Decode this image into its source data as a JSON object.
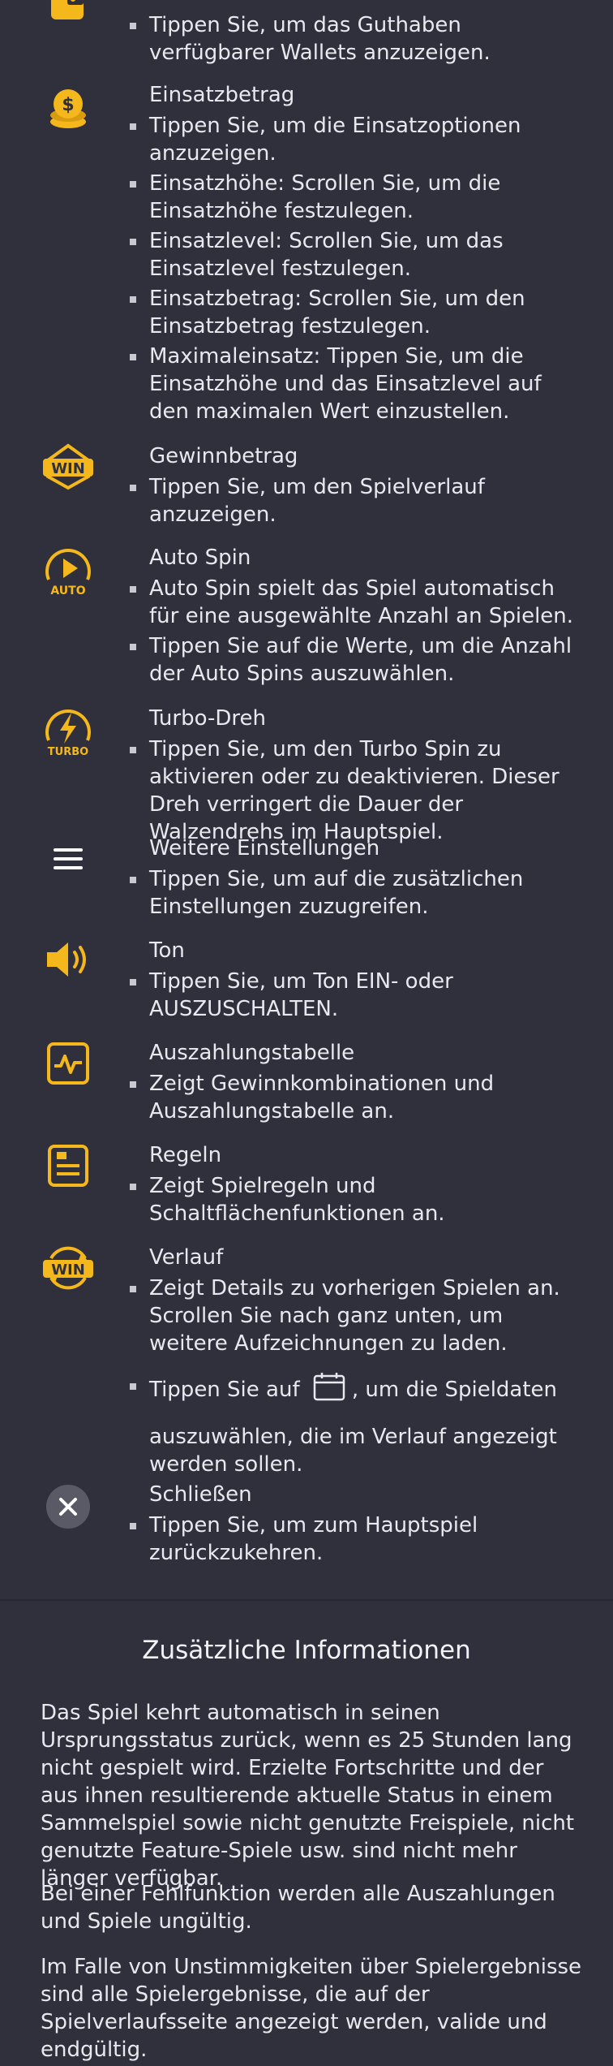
{
  "colors": {
    "background": "#30303c",
    "accent": "#f5b81c",
    "text": "#e8e8ee"
  },
  "items": [
    {
      "id": "wallet",
      "icon": "wallet-icon",
      "title": "",
      "bullets": [
        "Tippen Sie, um das Guthaben verfügbarer Wallets anzuzeigen."
      ]
    },
    {
      "id": "bet",
      "icon": "coin-stack-icon",
      "title": "Einsatzbetrag",
      "bullets": [
        "Tippen Sie, um die Einsatzoptionen anzuzeigen.",
        "Einsatzhöhe: Scrollen Sie, um die Einsatzhöhe festzulegen.",
        "Einsatzlevel: Scrollen Sie, um das Einsatzlevel festzulegen.",
        "Einsatzbetrag: Scrollen Sie, um den Einsatzbetrag festzulegen.",
        "Maximaleinsatz: Tippen Sie, um die Einsatzhöhe und das Einsatzlevel auf den maximalen Wert einzustellen."
      ]
    },
    {
      "id": "win",
      "icon": "win-badge-icon",
      "icon_text": "WIN",
      "title": "Gewinnbetrag",
      "bullets": [
        "Tippen Sie, um den Spielverlauf anzuzeigen."
      ]
    },
    {
      "id": "auto",
      "icon": "auto-spin-icon",
      "icon_text": "AUTO",
      "title": "Auto Spin",
      "bullets": [
        "Auto Spin spielt das Spiel automatisch für eine ausgewählte Anzahl an Spielen.",
        "Tippen Sie auf die Werte, um die Anzahl der Auto Spins auszuwählen."
      ]
    },
    {
      "id": "turbo",
      "icon": "turbo-icon",
      "icon_text": "TURBO",
      "title": "Turbo-Dreh",
      "bullets": [
        "Tippen Sie, um den Turbo Spin zu aktivieren oder zu deaktivieren. Dieser Dreh verringert die Dauer der Walzendrehs im Hauptspiel."
      ]
    },
    {
      "id": "settings",
      "icon": "menu-icon",
      "title": "Weitere Einstellungen",
      "bullets": [
        "Tippen Sie, um auf die zusätzlichen Einstellungen zuzugreifen."
      ]
    },
    {
      "id": "sound",
      "icon": "speaker-icon",
      "title": "Ton",
      "bullets": [
        "Tippen Sie, um Ton EIN- oder AUSZUSCHALTEN."
      ]
    },
    {
      "id": "paytable",
      "icon": "paytable-chart-icon",
      "title": "Auszahlungstabelle",
      "bullets": [
        "Zeigt Gewinnkombinationen und Auszahlungstabelle an."
      ]
    },
    {
      "id": "rules",
      "icon": "rules-document-icon",
      "title": "Regeln",
      "bullets": [
        "Zeigt Spielregeln und Schaltflächenfunktionen an."
      ]
    },
    {
      "id": "history",
      "icon": "history-win-icon",
      "icon_text": "WIN",
      "title": "Verlauf",
      "bullets": [
        "Zeigt Details zu vorherigen Spielen an. Scrollen Sie nach ganz unten, um weitere Aufzeichnungen zu laden."
      ],
      "calendar_bullet": {
        "before": "Tippen Sie auf",
        "after": ", um die Spieldaten",
        "rest": "auszuwählen, die im Verlauf angezeigt werden sollen."
      }
    },
    {
      "id": "close",
      "icon": "close-icon",
      "title": "Schließen",
      "bullets": [
        "Tippen Sie, um zum Hauptspiel zurückzukehren."
      ]
    }
  ],
  "additional": {
    "title": "Zusätzliche Informationen",
    "paragraphs": [
      "Das Spiel kehrt automatisch in seinen Ursprungsstatus zurück, wenn es 25 Stunden lang nicht gespielt wird. Erzielte Fortschritte und der aus ihnen resultierende aktuelle Status in einem Sammelspiel sowie nicht genutzte Freispiele, nicht genutzte Feature-Spiele usw. sind nicht mehr länger verfügbar.",
      "Bei einer Fehlfunktion werden alle Auszahlungen und Spiele ungültig.",
      "Im Falle von Unstimmigkeiten über Spielergebnisse sind alle Spielergebnisse, die auf der Spielverlaufsseite angezeigt werden, valide und endgültig."
    ]
  }
}
